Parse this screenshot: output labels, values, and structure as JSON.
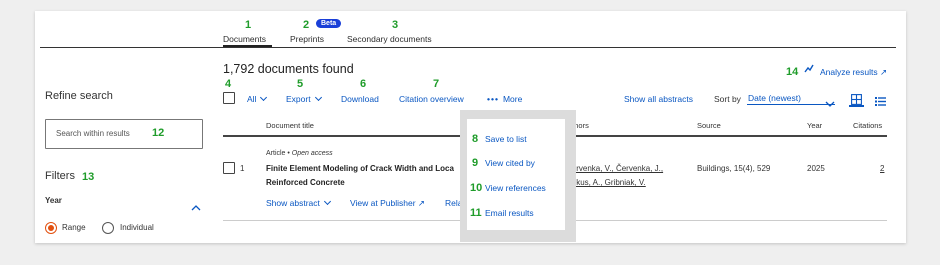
{
  "tabs": [
    {
      "num": "1",
      "label": "Documents"
    },
    {
      "num": "2",
      "label": "Preprints",
      "badge": "Beta"
    },
    {
      "num": "3",
      "label": "Secondary documents"
    }
  ],
  "results": {
    "count_label": "1,792 documents found"
  },
  "analyze": {
    "num": "14",
    "label": "Analyze results ↗"
  },
  "refine": {
    "title": "Refine search",
    "search_placeholder": "Search within results",
    "search_num": "12"
  },
  "filters": {
    "title": "Filters",
    "num": "13",
    "year_label": "Year",
    "range_label": "Range",
    "individual_label": "Individual"
  },
  "toolbar": {
    "select_num": "4",
    "all_label": "All",
    "export_num": "5",
    "export_label": "Export",
    "download_num": "6",
    "download_label": "Download",
    "citation_num": "7",
    "citation_label": "Citation overview",
    "more_label": "More",
    "show_abstracts_label": "Show all abstracts",
    "sort_label": "Sort by",
    "sort_value": "Date (newest)"
  },
  "table": {
    "headers": {
      "title": "Document title",
      "authors": "Authors",
      "source": "Source",
      "year": "Year",
      "citations": "Citations"
    }
  },
  "row": {
    "index": "1",
    "type": "Article",
    "access": "Open access",
    "title_line1": "Finite Element Modeling of Crack Width and Loca",
    "title_line2": "Reinforced Concrete",
    "authors_line1": "Červenka, V., Červenka, J.,",
    "authors_line2": "Jinkus, A., Gribniak, V.",
    "source": "Buildings, 15(4), 529",
    "year": "2025",
    "citations": "2",
    "show_abstract": "Show abstract",
    "view_publisher": "View at Publisher ↗",
    "related": "Relate"
  },
  "menu": {
    "items": [
      {
        "num": "8",
        "label": "Save to list"
      },
      {
        "num": "9",
        "label": "View cited by"
      },
      {
        "num": "10",
        "label": "View references"
      },
      {
        "num": "11",
        "label": "Email results"
      }
    ]
  },
  "colors": {
    "accent": "#0a57c2",
    "annotation": "#1f9c2a",
    "radio_active": "#e2500f"
  }
}
